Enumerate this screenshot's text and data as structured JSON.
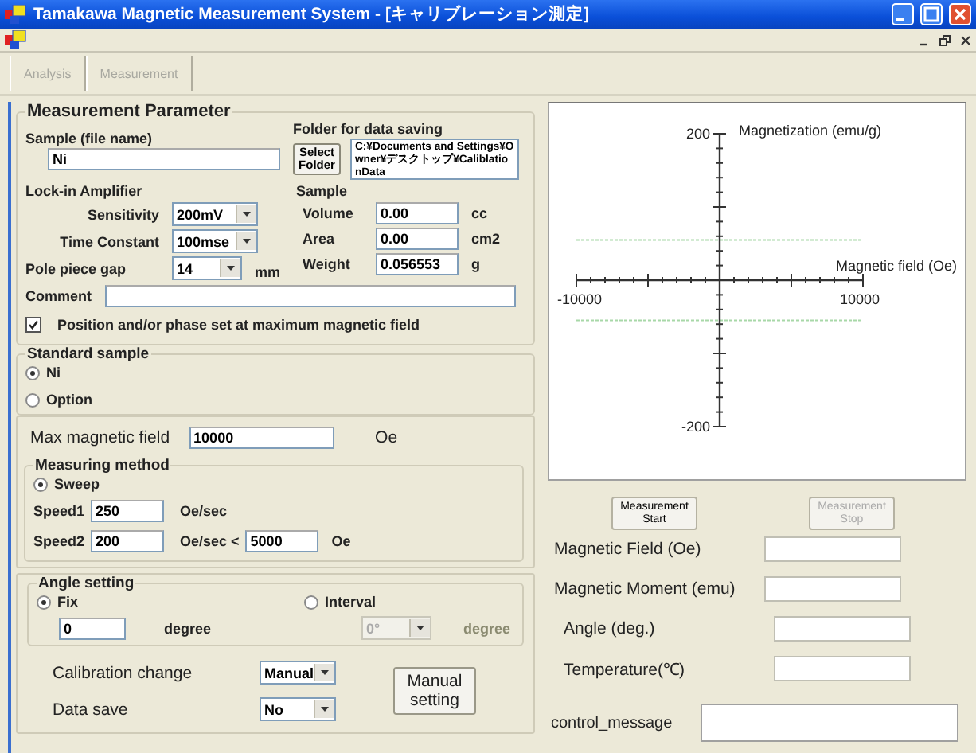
{
  "window": {
    "title": "Tamakawa Magnetic Measurement System  - [キャリブレーション測定]"
  },
  "toolbar": [
    {
      "label": "Analysis",
      "disabled": true
    },
    {
      "label": "Measurement",
      "disabled": true
    }
  ],
  "parameters": {
    "title": "Measurement Parameter",
    "sample_label": "Sample (file name)",
    "sample_value": "Ni",
    "folder_label": "Folder for data saving",
    "select_folder_button": "Select Folder",
    "folder_path": "C:¥Documents and Settings¥Owner¥デスクトップ¥CaliblationData",
    "lockin": {
      "title": "Lock-in Amplifier",
      "rows": [
        {
          "label": "Sensitivity",
          "value": "200mV"
        },
        {
          "label": "Time Constant",
          "value": "100mse"
        }
      ]
    },
    "pole_gap": {
      "label": "Pole piece gap",
      "value": "14",
      "unit": "mm"
    },
    "sample": {
      "title": "Sample",
      "rows": [
        {
          "label": "Volume",
          "value": "0.00",
          "unit": "cc"
        },
        {
          "label": "Area",
          "value": "0.00",
          "unit": "cm2"
        },
        {
          "label": "Weight",
          "value": "0.056553",
          "unit": "g"
        }
      ]
    },
    "comment_label": "Comment",
    "checkbox": {
      "label": "Position and/or phase set at maximum magnetic field",
      "checked": true
    }
  },
  "standard_sample": {
    "title": "Standard sample",
    "options": [
      {
        "label": "Ni",
        "selected": true
      },
      {
        "label": "Option",
        "selected": false
      }
    ]
  },
  "max_field": {
    "label": "Max magnetic field",
    "value": "10000",
    "unit": "Oe"
  },
  "measuring_method": {
    "title": "Measuring method",
    "options": [
      {
        "label": "Sweep",
        "selected": true
      }
    ],
    "speed1": {
      "label": "Speed1",
      "value": "250",
      "unit": "Oe/sec"
    },
    "speed2": {
      "label": "Speed2",
      "value": "200",
      "unit": "Oe/sec <",
      "limit": "5000",
      "limit_unit": "Oe"
    }
  },
  "angle": {
    "title": "Angle setting",
    "options": [
      {
        "label": "Fix",
        "selected": true
      },
      {
        "label": "Interval",
        "selected": false
      }
    ],
    "fix_value": "0",
    "fix_unit": "degree",
    "interval_value": "0°",
    "interval_unit": "degree",
    "interval_disabled": true
  },
  "calibration": {
    "label": "Calibration change",
    "value": "Manual"
  },
  "data_save": {
    "label": "Data save",
    "value": "No"
  },
  "manual_button": "Manual setting",
  "chart": {
    "chart_data": {
      "type": "line",
      "xlabel": "Magnetic field (Oe)",
      "ylabel": "Magnetization (emu/g)",
      "x": [
        -10000,
        10000
      ],
      "xlim": [
        -10000,
        10000
      ],
      "ylim": [
        -200,
        200
      ],
      "xticks": [
        -10000,
        10000
      ],
      "yticks": [
        -200,
        200
      ],
      "series": [
        {
          "color": "#a8d8a8",
          "line_style": "dashed",
          "values": [
            55,
            55
          ]
        },
        {
          "color": "#a8d8a8",
          "line_style": "dashed",
          "values": [
            -55,
            -55
          ]
        }
      ]
    }
  },
  "measure_buttons": [
    {
      "label": "Measurement Start",
      "disabled": false
    },
    {
      "label": "Measurement Stop",
      "disabled": true
    }
  ],
  "readouts": [
    {
      "label": "Magnetic Field (Oe)"
    },
    {
      "label": "Magnetic Moment (emu)"
    },
    {
      "label": "Angle (deg.)"
    },
    {
      "label": "Temperature(℃)"
    }
  ],
  "control_message": {
    "label": "control_message"
  }
}
